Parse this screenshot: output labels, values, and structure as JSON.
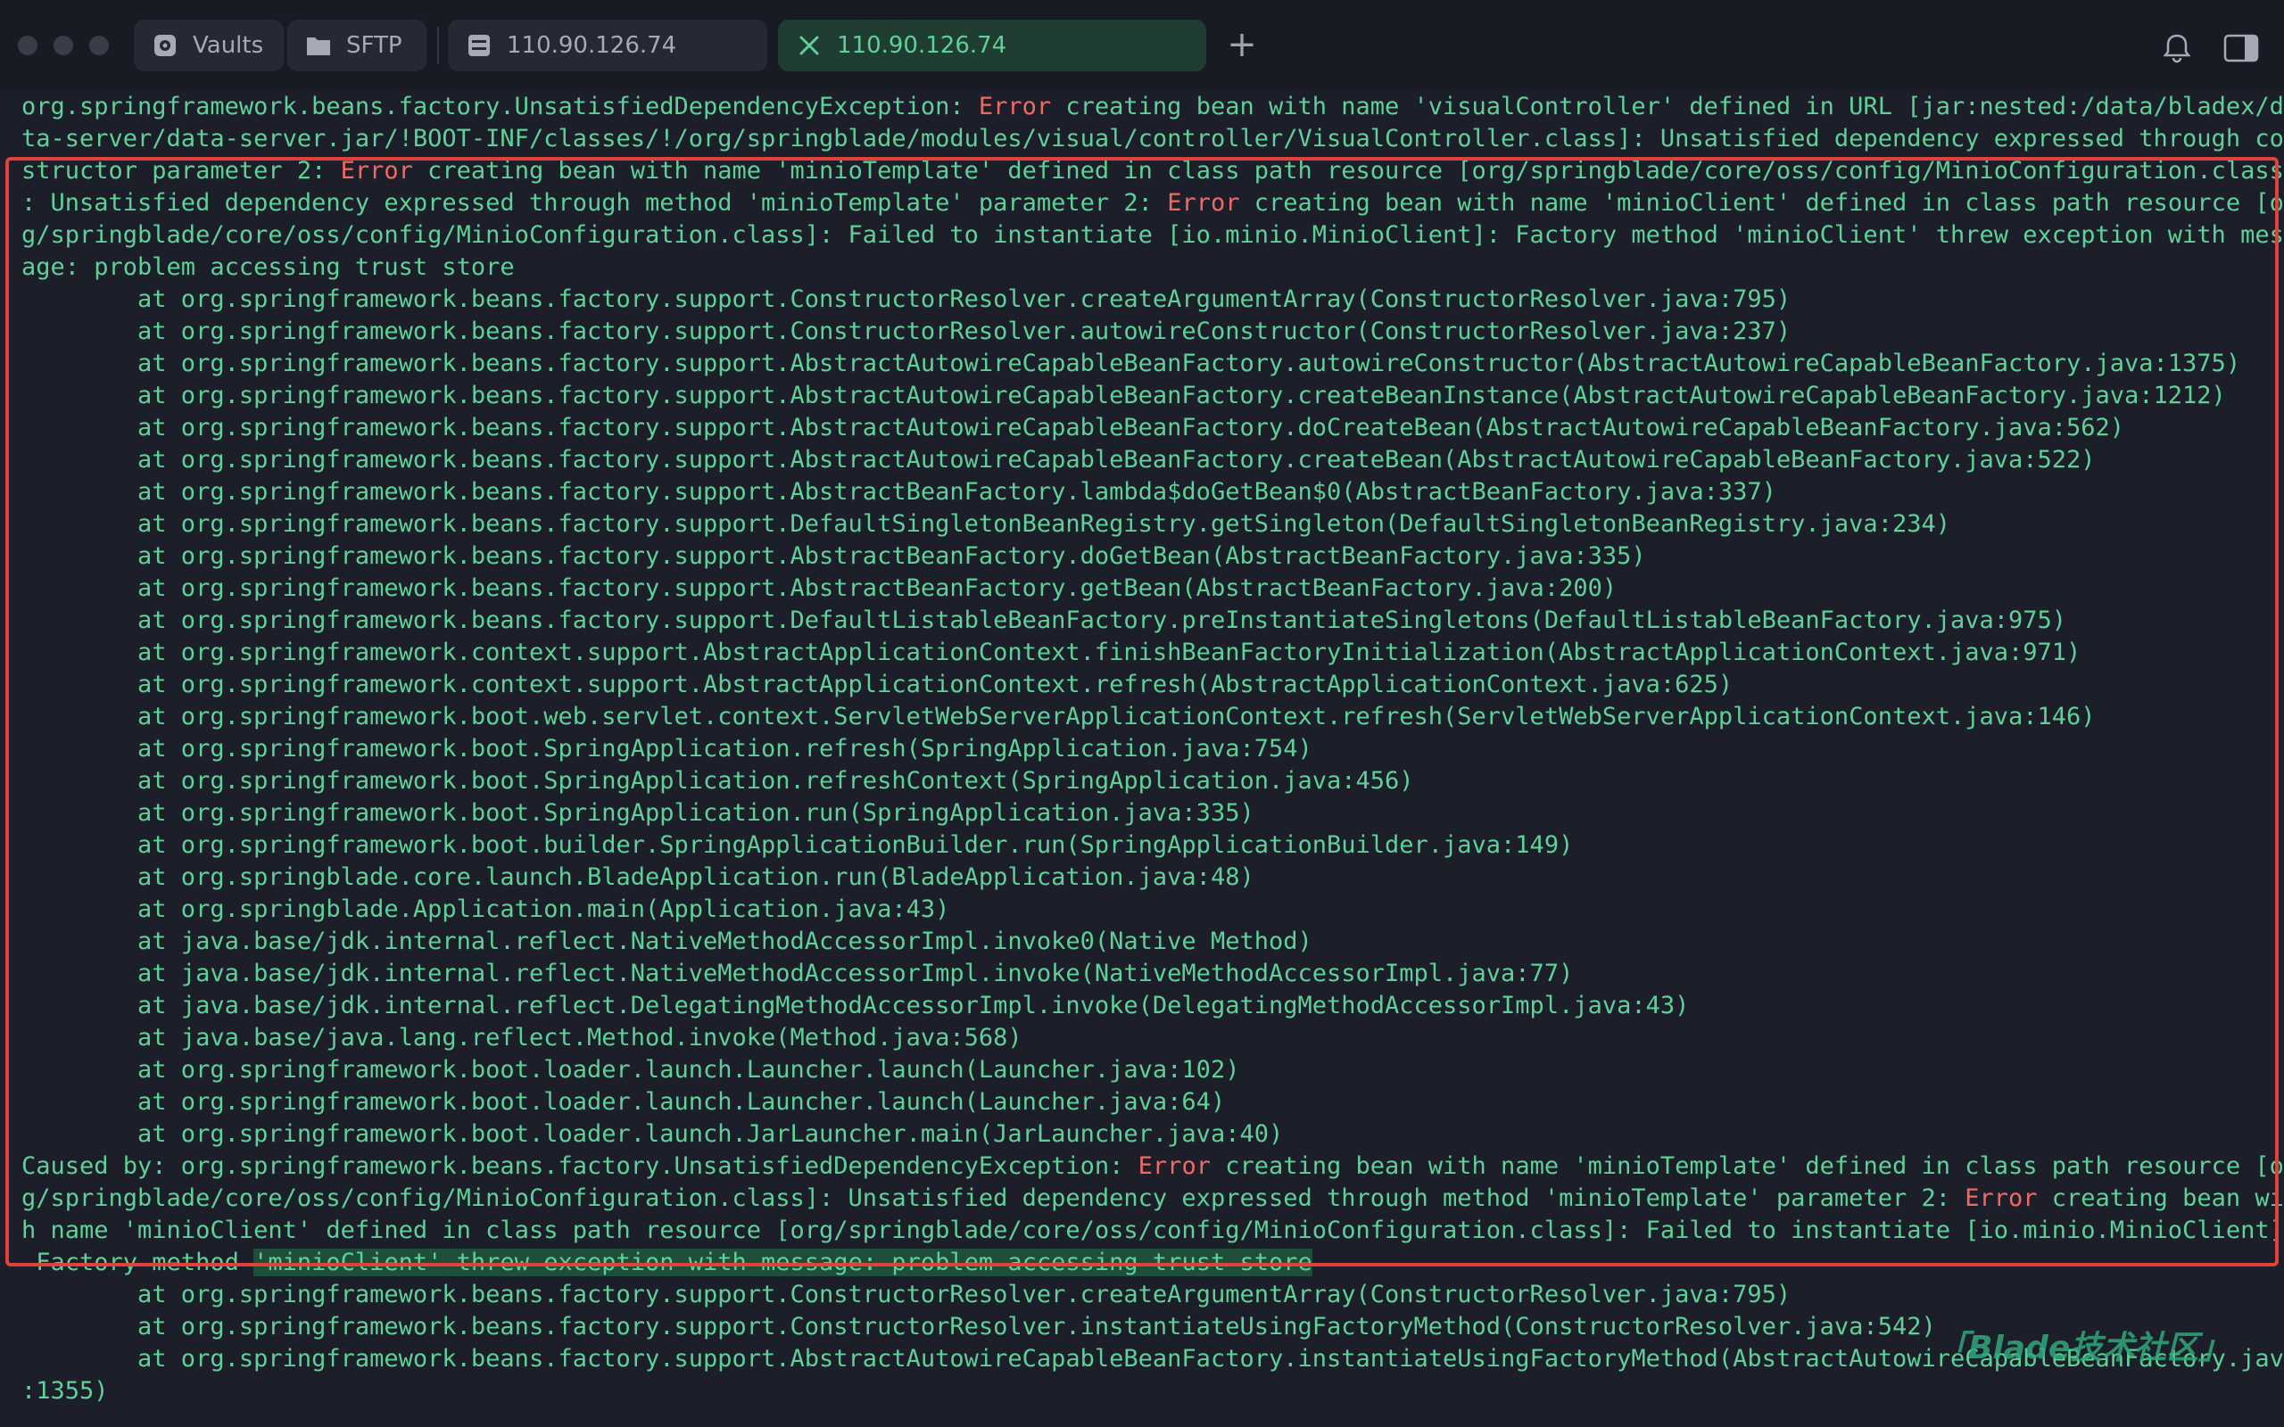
{
  "tabs": {
    "vaults": "Vaults",
    "sftp": "SFTP",
    "host1": "110.90.126.74",
    "host2": "110.90.126.74",
    "new_tab": "+"
  },
  "terminal": {
    "lines": [
      [
        [
          "org.springframework.beans.factory.UnsatisfiedDependencyException: ",
          ""
        ],
        [
          "Error",
          "err"
        ],
        [
          " creating bean with name 'visualController' defined in URL [jar:nested:/data/bladex/da",
          ""
        ]
      ],
      [
        [
          "ta-server/data-server.jar/!BOOT-INF/classes/!/org/springblade/modules/visual/controller/VisualController.class]: Unsatisfied dependency expressed through con",
          ""
        ]
      ],
      [
        [
          "structor parameter 2: ",
          ""
        ],
        [
          "Error",
          "err"
        ],
        [
          " creating bean with name 'minioTemplate' defined in class path resource [org/springblade/core/oss/config/MinioConfiguration.class]",
          ""
        ]
      ],
      [
        [
          ": Unsatisfied dependency expressed through method 'minioTemplate' parameter 2: ",
          ""
        ],
        [
          "Error",
          "err"
        ],
        [
          " creating bean with name 'minioClient' defined in class path resource [or",
          ""
        ]
      ],
      [
        [
          "g/springblade/core/oss/config/MinioConfiguration.class]: Failed to instantiate [io.minio.MinioClient]: Factory method 'minioClient' threw exception with mess",
          ""
        ]
      ],
      [
        [
          "age: problem accessing trust store",
          ""
        ]
      ],
      [
        [
          "        at org.springframework.beans.factory.support.ConstructorResolver.createArgumentArray(ConstructorResolver.java:795)",
          ""
        ]
      ],
      [
        [
          "        at org.springframework.beans.factory.support.ConstructorResolver.autowireConstructor(ConstructorResolver.java:237)",
          ""
        ]
      ],
      [
        [
          "        at org.springframework.beans.factory.support.AbstractAutowireCapableBeanFactory.autowireConstructor(AbstractAutowireCapableBeanFactory.java:1375)",
          ""
        ]
      ],
      [
        [
          "        at org.springframework.beans.factory.support.AbstractAutowireCapableBeanFactory.createBeanInstance(AbstractAutowireCapableBeanFactory.java:1212)",
          ""
        ]
      ],
      [
        [
          "        at org.springframework.beans.factory.support.AbstractAutowireCapableBeanFactory.doCreateBean(AbstractAutowireCapableBeanFactory.java:562)",
          ""
        ]
      ],
      [
        [
          "        at org.springframework.beans.factory.support.AbstractAutowireCapableBeanFactory.createBean(AbstractAutowireCapableBeanFactory.java:522)",
          ""
        ]
      ],
      [
        [
          "        at org.springframework.beans.factory.support.AbstractBeanFactory.lambda$doGetBean$0(AbstractBeanFactory.java:337)",
          ""
        ]
      ],
      [
        [
          "        at org.springframework.beans.factory.support.DefaultSingletonBeanRegistry.getSingleton(DefaultSingletonBeanRegistry.java:234)",
          ""
        ]
      ],
      [
        [
          "        at org.springframework.beans.factory.support.AbstractBeanFactory.doGetBean(AbstractBeanFactory.java:335)",
          ""
        ]
      ],
      [
        [
          "        at org.springframework.beans.factory.support.AbstractBeanFactory.getBean(AbstractBeanFactory.java:200)",
          ""
        ]
      ],
      [
        [
          "        at org.springframework.beans.factory.support.DefaultListableBeanFactory.preInstantiateSingletons(DefaultListableBeanFactory.java:975)",
          ""
        ]
      ],
      [
        [
          "        at org.springframework.context.support.AbstractApplicationContext.finishBeanFactoryInitialization(AbstractApplicationContext.java:971)",
          ""
        ]
      ],
      [
        [
          "        at org.springframework.context.support.AbstractApplicationContext.refresh(AbstractApplicationContext.java:625)",
          ""
        ]
      ],
      [
        [
          "        at org.springframework.boot.web.servlet.context.ServletWebServerApplicationContext.refresh(ServletWebServerApplicationContext.java:146)",
          ""
        ]
      ],
      [
        [
          "        at org.springframework.boot.SpringApplication.refresh(SpringApplication.java:754)",
          ""
        ]
      ],
      [
        [
          "        at org.springframework.boot.SpringApplication.refreshContext(SpringApplication.java:456)",
          ""
        ]
      ],
      [
        [
          "        at org.springframework.boot.SpringApplication.run(SpringApplication.java:335)",
          ""
        ]
      ],
      [
        [
          "        at org.springframework.boot.builder.SpringApplicationBuilder.run(SpringApplicationBuilder.java:149)",
          ""
        ]
      ],
      [
        [
          "        at org.springblade.core.launch.BladeApplication.run(BladeApplication.java:48)",
          ""
        ]
      ],
      [
        [
          "        at org.springblade.Application.main(Application.java:43)",
          ""
        ]
      ],
      [
        [
          "        at java.base/jdk.internal.reflect.NativeMethodAccessorImpl.invoke0(Native Method)",
          ""
        ]
      ],
      [
        [
          "        at java.base/jdk.internal.reflect.NativeMethodAccessorImpl.invoke(NativeMethodAccessorImpl.java:77)",
          ""
        ]
      ],
      [
        [
          "        at java.base/jdk.internal.reflect.DelegatingMethodAccessorImpl.invoke(DelegatingMethodAccessorImpl.java:43)",
          ""
        ]
      ],
      [
        [
          "        at java.base/java.lang.reflect.Method.invoke(Method.java:568)",
          ""
        ]
      ],
      [
        [
          "        at org.springframework.boot.loader.launch.Launcher.launch(Launcher.java:102)",
          ""
        ]
      ],
      [
        [
          "        at org.springframework.boot.loader.launch.Launcher.launch(Launcher.java:64)",
          ""
        ]
      ],
      [
        [
          "        at org.springframework.boot.loader.launch.JarLauncher.main(JarLauncher.java:40)",
          ""
        ]
      ],
      [
        [
          "Caused by: org.springframework.beans.factory.UnsatisfiedDependencyException: ",
          ""
        ],
        [
          "Error",
          "err"
        ],
        [
          " creating bean with name 'minioTemplate' defined in class path resource [or",
          ""
        ]
      ],
      [
        [
          "g/springblade/core/oss/config/MinioConfiguration.class]: Unsatisfied dependency expressed through method 'minioTemplate' parameter 2: ",
          ""
        ],
        [
          "Error",
          "err"
        ],
        [
          " creating bean wit",
          ""
        ]
      ],
      [
        [
          "h name 'minioClient' defined in class path resource [org/springblade/core/oss/config/MinioConfiguration.class]: Failed to instantiate [io.minio.MinioClient]:",
          ""
        ]
      ],
      [
        [
          " Factory method ",
          ""
        ],
        [
          "'minioClient' threw exception with message: problem accessing trust store",
          "hl"
        ]
      ],
      [
        [
          "        at org.springframework.beans.factory.support.ConstructorResolver.createArgumentArray(ConstructorResolver.java:795)",
          ""
        ]
      ],
      [
        [
          "        at org.springframework.beans.factory.support.ConstructorResolver.instantiateUsingFactoryMethod(ConstructorResolver.java:542)",
          ""
        ]
      ],
      [
        [
          "        at org.springframework.beans.factory.support.AbstractAutowireCapableBeanFactory.instantiateUsingFactoryMethod(AbstractAutowireCapableBeanFactory.java",
          ""
        ]
      ],
      [
        [
          ":1355)",
          ""
        ]
      ]
    ]
  },
  "watermark": "「Blade技术社区」"
}
